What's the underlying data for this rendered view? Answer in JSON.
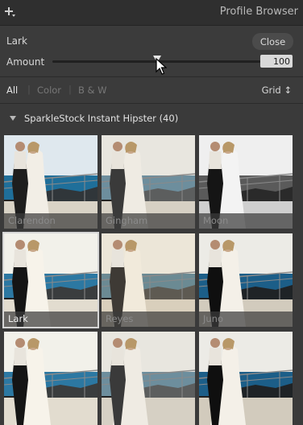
{
  "header": {
    "title": "Profile Browser",
    "add_icon": "plus-icon"
  },
  "profile": {
    "name": "Lark",
    "close_label": "Close",
    "amount_label": "Amount",
    "amount_value": "100",
    "amount_fraction": 0.5
  },
  "filters": {
    "items": [
      "All",
      "Color",
      "B & W"
    ],
    "active": "All",
    "view_select": "Grid ↕"
  },
  "group": {
    "title": "SparkleStock Instant Hipster (40)"
  },
  "thumbnails": [
    {
      "label": "Clarendon",
      "style": "color-cool"
    },
    {
      "label": "Gingham",
      "style": "faded"
    },
    {
      "label": "Moon",
      "style": "bw"
    },
    {
      "label": "Lark",
      "style": "color-bright",
      "selected": true
    },
    {
      "label": "Reyes",
      "style": "faded-warm"
    },
    {
      "label": "Juno",
      "style": "color-contrast"
    },
    {
      "label": "",
      "style": "color-bright"
    },
    {
      "label": "",
      "style": "faded"
    },
    {
      "label": "",
      "style": "color-contrast"
    }
  ]
}
